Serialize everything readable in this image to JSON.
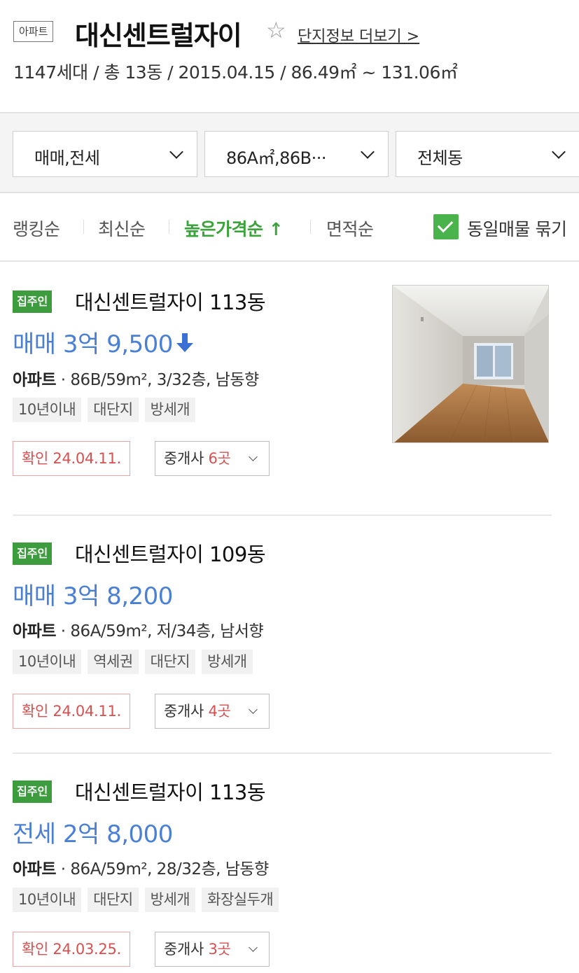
{
  "header": {
    "type_badge": "아파트",
    "title": "대신센트럴자이",
    "more_link": "단지정보 더보기 >",
    "summary": "1147세대 / 총 13동 / 2015.04.15 / 86.49㎡ ~ 131.06㎡"
  },
  "filters": {
    "trade_type": "매매,전세",
    "area": "86A㎡,86B···",
    "building": "전체동"
  },
  "sort": {
    "options": [
      "랭킹순",
      "최신순",
      "높은가격순 ↑",
      "면적순"
    ],
    "active": "높은가격순 ↑",
    "group_same_label": "동일매물 묶기",
    "group_same_checked": true
  },
  "listings": [
    {
      "badge": "집주인",
      "name": "대신센트럴자이 113동",
      "price": "매매 3억 9,500",
      "price_drop": true,
      "kind": "아파트",
      "spec": "86B/59m², 3/32층, 남동향",
      "tags": [
        "10년이내",
        "대단지",
        "방세개"
      ],
      "confirmed": "확인 24.04.11.",
      "broker_label": "중개사",
      "broker_count": "6곳",
      "has_photo": true
    },
    {
      "badge": "집주인",
      "name": "대신센트럴자이 109동",
      "price": "매매 3억 8,200",
      "price_drop": false,
      "kind": "아파트",
      "spec": "86A/59m², 저/34층, 남서향",
      "tags": [
        "10년이내",
        "역세권",
        "대단지",
        "방세개"
      ],
      "confirmed": "확인 24.04.11.",
      "broker_label": "중개사",
      "broker_count": "4곳",
      "has_photo": false
    },
    {
      "badge": "집주인",
      "name": "대신센트럴자이 113동",
      "price": "전세 2억 8,000",
      "price_drop": false,
      "kind": "아파트",
      "spec": "86A/59m², 28/32층, 남동향",
      "tags": [
        "10년이내",
        "대단지",
        "방세개",
        "화장실두개"
      ],
      "confirmed": "확인 24.03.25.",
      "broker_label": "중개사",
      "broker_count": "3곳",
      "has_photo": false
    }
  ],
  "colors": {
    "accent_green": "#3d9c3d",
    "price_blue": "#4a7fd6",
    "confirm_red": "#d65050"
  }
}
